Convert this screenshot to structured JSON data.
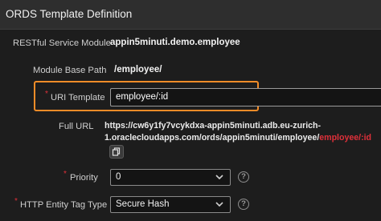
{
  "header": {
    "title": "ORDS Template Definition"
  },
  "fields": {
    "restful_service_module": {
      "label": "RESTful Service Module",
      "value": "appin5minuti.demo.employee"
    },
    "module_base_path": {
      "label": "Module Base Path",
      "value": "/employee/"
    },
    "uri_template": {
      "required_mark": "*",
      "label": "URI Template",
      "value": "employee/:id"
    },
    "full_url": {
      "label": "Full URL",
      "line1": "https://cw6y1fy7vcykdxa-appin5minuti.adb.eu-zurich-",
      "line2_main": "1.oraclecloudapps.com/ords/appin5minuti/employee/",
      "line2_highlight": "employee/:id",
      "copy_icon": "copy-icon"
    },
    "priority": {
      "required_mark": "*",
      "label": "Priority",
      "value": "0",
      "help_symbol": "?"
    },
    "http_entity_tag_type": {
      "required_mark": "*",
      "label": "HTTP Entity Tag Type",
      "value": "Secure Hash",
      "help_symbol": "?"
    }
  },
  "colors": {
    "background": "#1d1d1d",
    "focus_outline": "#f28c28",
    "required": "#e0303a"
  }
}
